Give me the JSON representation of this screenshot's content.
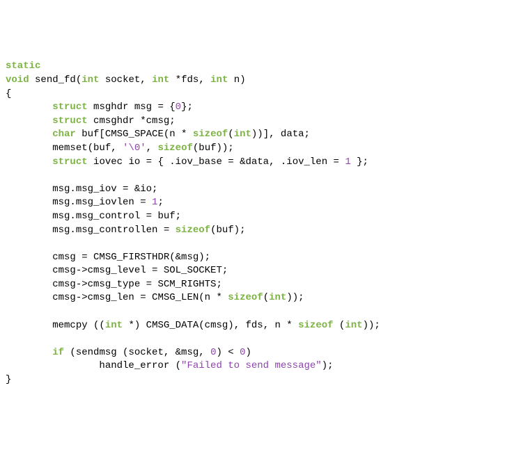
{
  "keywords": {
    "static": "static",
    "void": "void",
    "int": "int",
    "struct": "struct",
    "char": "char",
    "sizeof": "sizeof",
    "if": "if"
  },
  "fn": {
    "name": "send_fd",
    "param1": "socket",
    "param2": "fds",
    "param3": "n"
  },
  "body": {
    "l1_a": " msghdr msg = {",
    "l1_num": "0",
    "l1_b": "};",
    "l2": " cmsghdr *cmsg;",
    "l3_a": " buf[CMSG_SPACE(n * ",
    "l3_b": "(",
    "l3_c": "))], data;",
    "l4_a": "memset(buf, ",
    "l4_char": "'\\0'",
    "l4_b": ", ",
    "l4_c": "(buf));",
    "l5_a": " iovec io = { .iov_base = &data, .iov_len = ",
    "l5_num": "1",
    "l5_b": " };",
    "l6": "msg.msg_iov = &io;",
    "l7_a": "msg.msg_iovlen = ",
    "l7_num": "1",
    "l7_b": ";",
    "l8": "msg.msg_control = buf;",
    "l9_a": "msg.msg_controllen = ",
    "l9_b": "(buf);",
    "l10": "cmsg = CMSG_FIRSTHDR(&msg);",
    "l11": "cmsg->cmsg_level = SOL_SOCKET;",
    "l12": "cmsg->cmsg_type = SCM_RIGHTS;",
    "l13_a": "cmsg->cmsg_len = CMSG_LEN(n * ",
    "l13_b": "(",
    "l13_c": "));",
    "l14_a": "memcpy ((",
    "l14_b": " *) CMSG_DATA(cmsg), fds, n * ",
    "l14_c": " (",
    "l14_d": "));",
    "l15_a": " (sendmsg (socket, &msg, ",
    "l15_num1": "0",
    "l15_b": ") < ",
    "l15_num2": "0",
    "l15_c": ")",
    "l16_a": "handle_error (",
    "l16_str": "\"Failed to send message\"",
    "l16_b": ");"
  },
  "punct": {
    "open_paren": "(",
    "close_paren": ")",
    "comma_sp": ", ",
    "sp_star": " *",
    "sp": " ",
    "open_brace": "{",
    "close_brace": "}"
  }
}
